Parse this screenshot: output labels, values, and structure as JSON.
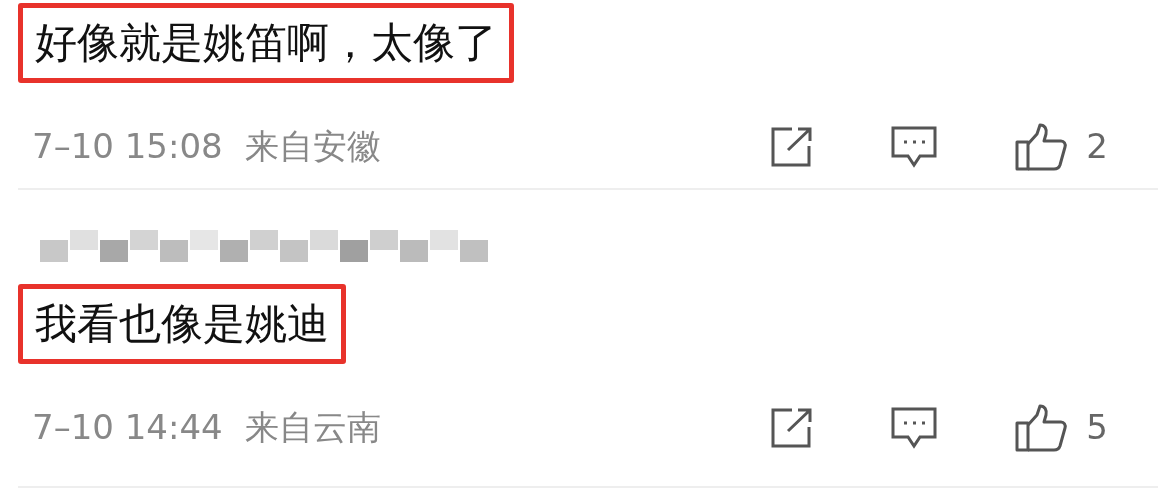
{
  "comments": [
    {
      "author_hidden": false,
      "text": "好像就是姚笛啊，太像了",
      "highlighted": true,
      "time": "7–10 15:08",
      "location": "来自安徽",
      "likes": "2"
    },
    {
      "author_hidden": true,
      "text": "我看也像是姚迪",
      "highlighted": true,
      "time": "7–10 14:44",
      "location": "来自云南",
      "likes": "5"
    }
  ]
}
